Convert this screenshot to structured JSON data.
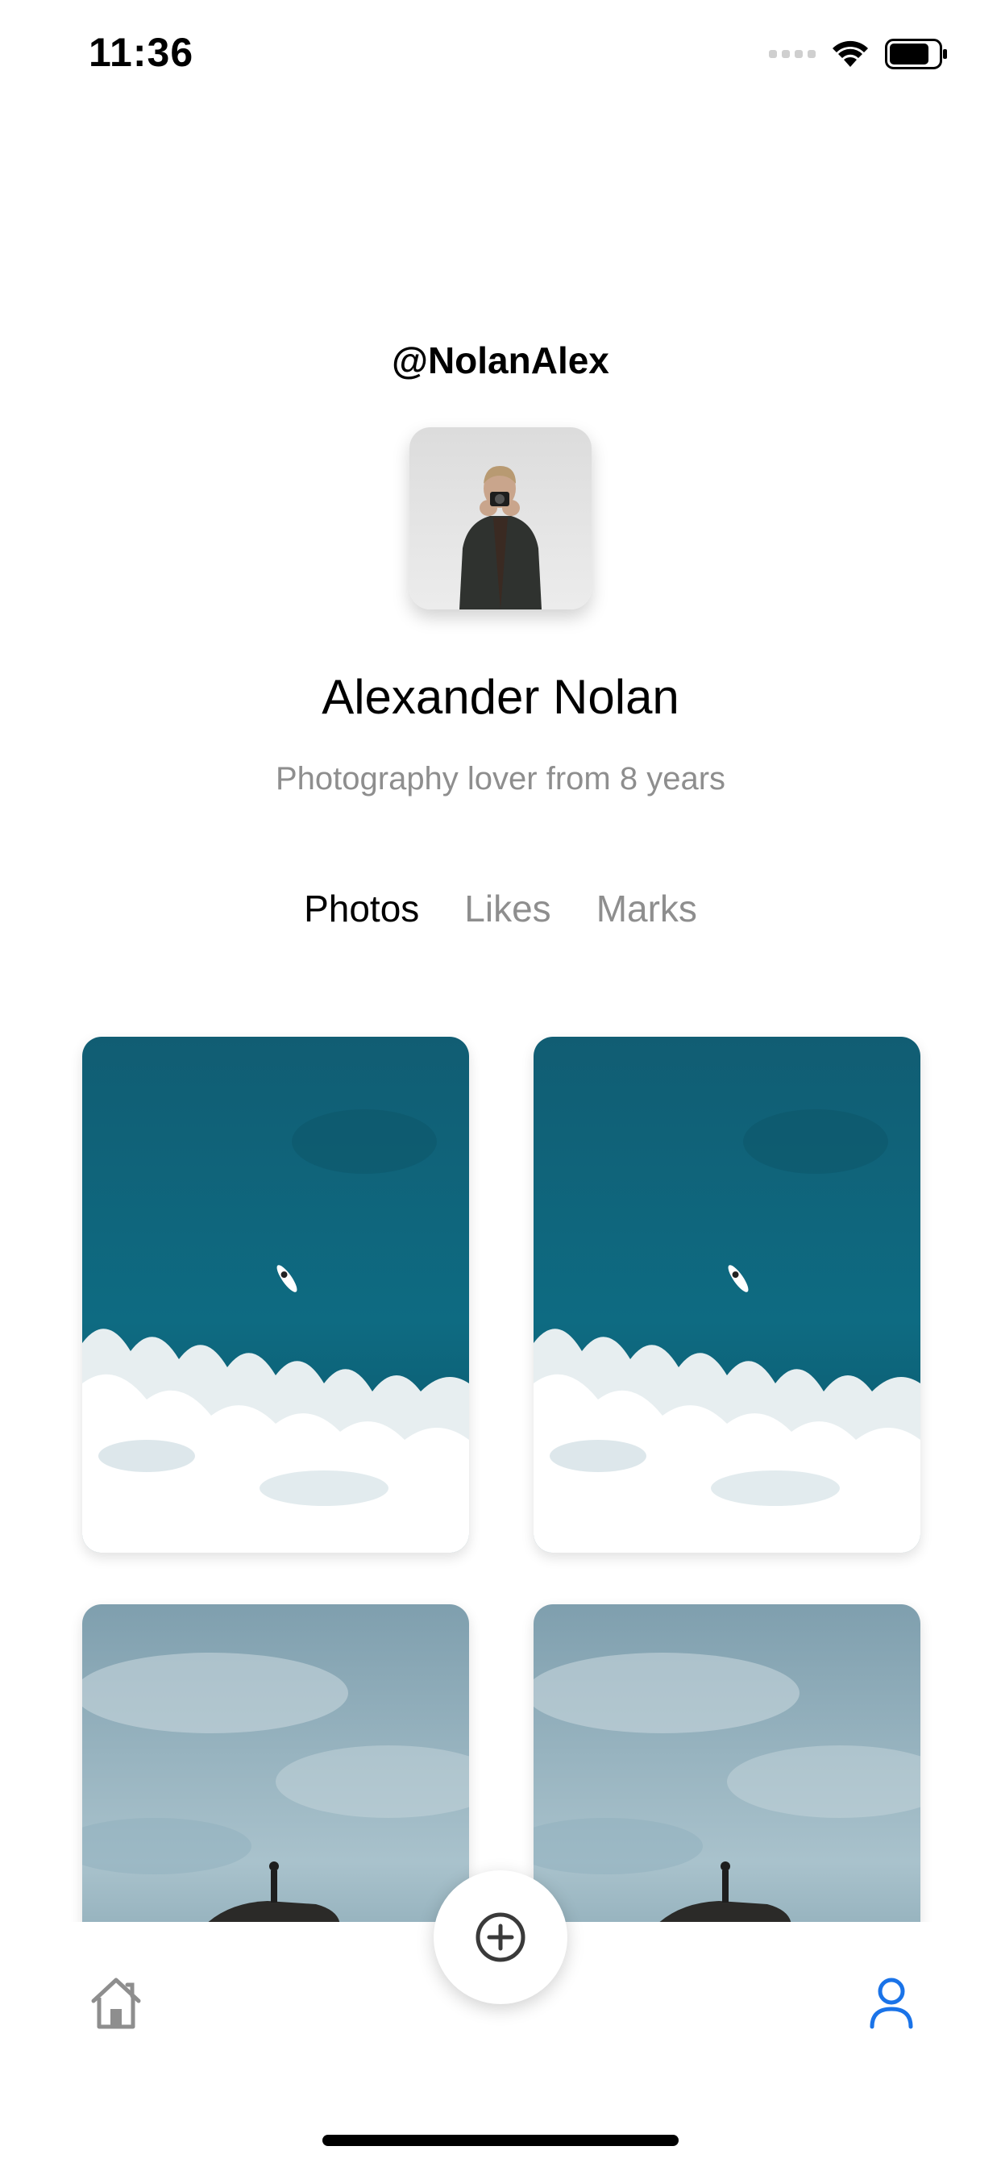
{
  "status_bar": {
    "time": "11:36",
    "icons": [
      "signal-icon",
      "wifi-icon",
      "battery-icon"
    ]
  },
  "profile": {
    "username": "@NolanAlex",
    "name": "Alexander Nolan",
    "bio": "Photography lover from 8 years"
  },
  "tabs": [
    {
      "label": "Photos",
      "active": true
    },
    {
      "label": "Likes",
      "active": false
    },
    {
      "label": "Marks",
      "active": false
    }
  ],
  "photos": [
    {
      "subject": "aerial ocean wave with surfer"
    },
    {
      "subject": "aerial ocean wave with surfer"
    },
    {
      "subject": "hiker on rock under cloudy sky"
    },
    {
      "subject": "hiker on rock under cloudy sky"
    }
  ],
  "nav": {
    "items": [
      "home-icon",
      "add-icon",
      "profile-icon"
    ],
    "active": "profile-icon",
    "active_color": "#1a73e8",
    "inactive_color": "#8e8e8e"
  }
}
